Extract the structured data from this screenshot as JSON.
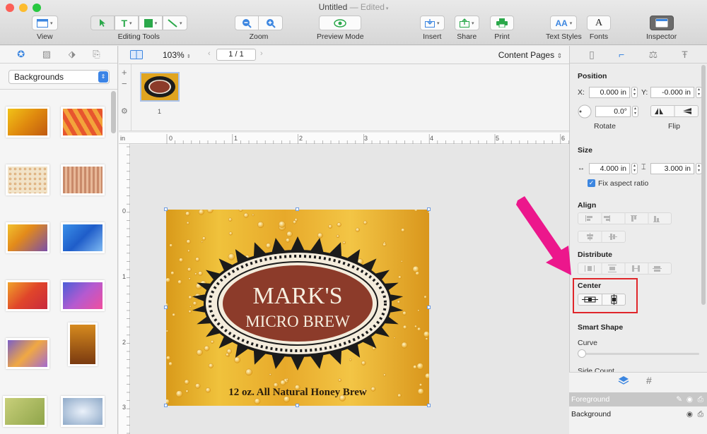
{
  "window": {
    "title": "Untitled",
    "edited": "— Edited"
  },
  "toolbar": {
    "view_label": "View",
    "editing_tools_label": "Editing Tools",
    "zoom_label": "Zoom",
    "preview_label": "Preview Mode",
    "insert_label": "Insert",
    "share_label": "Share",
    "print_label": "Print",
    "text_styles_label": "Text Styles",
    "fonts_label": "Fonts",
    "inspector_label": "Inspector"
  },
  "sidebar": {
    "category_selected": "Backgrounds"
  },
  "navbar": {
    "zoom": "103%",
    "page": "1 / 1",
    "content_pages": "Content Pages"
  },
  "page_sidebar": {
    "page_number": "1"
  },
  "rulers": {
    "unit": "in",
    "top_ticks": [
      "0",
      "1",
      "2",
      "3",
      "4",
      "5",
      "6"
    ],
    "left_ticks": [
      "0",
      "1",
      "2",
      "3"
    ]
  },
  "artwork": {
    "line1": "MARK'S",
    "line2": "MICRO BREW",
    "tagline": "12 oz. All Natural Honey Brew"
  },
  "inspector": {
    "position_title": "Position",
    "x_label": "X:",
    "x_value": "0.000 in",
    "y_label": "Y:",
    "y_value": "-0.000 in",
    "rotate_value": "0.0°",
    "rotate_label": "Rotate",
    "flip_label": "Flip",
    "size_title": "Size",
    "width_value": "4.000 in",
    "height_value": "3.000 in",
    "fix_aspect_label": "Fix aspect ratio",
    "align_title": "Align",
    "distribute_title": "Distribute",
    "center_title": "Center",
    "smart_shape_title": "Smart Shape",
    "curve_label": "Curve",
    "side_count_label": "Side Count"
  },
  "layers": {
    "foreground": "Foreground",
    "background": "Background"
  },
  "colors": {
    "accent": "#3c86e0",
    "arrow": "#ec178c",
    "highlight": "#e0262a"
  }
}
